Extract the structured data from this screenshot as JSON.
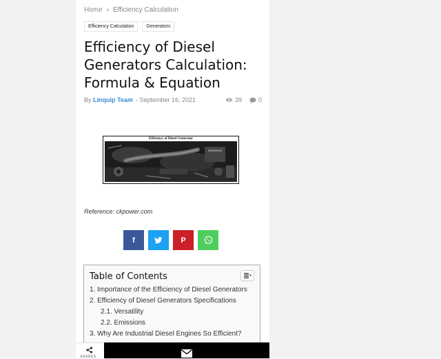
{
  "breadcrumb": {
    "home": "Home",
    "separator": "›",
    "current": "Efficiency Calculation"
  },
  "tags": [
    "Efficiency Calculation",
    "Generators"
  ],
  "article": {
    "title": "Efficiency of Diesel Generators Calculation: Formula & Equation",
    "by": "By",
    "author": "Linquip Team",
    "date": "- September 16, 2021",
    "views": "39",
    "comments": "0",
    "figure_caption": "Efficiency of Diesel Generator",
    "reference": "Reference: ckpower.com"
  },
  "share": {
    "facebook": "f",
    "pinterest": "P",
    "bottom_label": "SHARES"
  },
  "toc": {
    "title": "Table of Contents",
    "items": [
      "1. Importance of the Efficiency of Diesel Generators",
      "2. Efficiency of Diesel Generators Specifications",
      "2.1. Versatility",
      "2.2. Emissions",
      "3. Why Are Industrial Diesel Engines So Efficient?"
    ]
  },
  "colors": {
    "facebook": "#3b5998",
    "twitter": "#1da1f2",
    "pinterest": "#cb2027",
    "whatsapp": "#4fce5d",
    "author_link": "#3b8ad6"
  }
}
